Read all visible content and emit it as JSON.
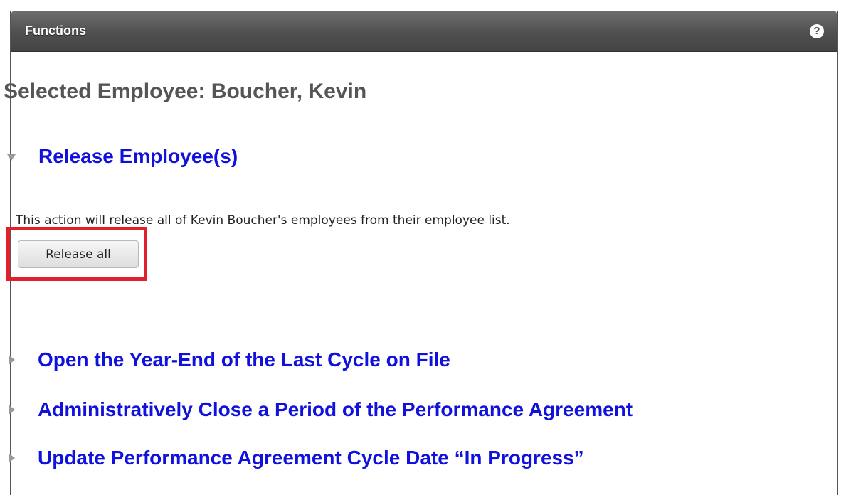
{
  "header": {
    "title": "Functions",
    "help_icon": "question-mark-icon",
    "help_glyph": "?"
  },
  "selected_employee": "Selected Employee: Boucher, Kevin",
  "release_section": {
    "title": "Release Employee(s)",
    "expanded": true,
    "description": "This action will release all of Kevin Boucher's employees from their employee list.",
    "button_label": "Release all",
    "highlight_color": "#e0212b"
  },
  "collapsed_sections": [
    "Open the Year-End of the Last Cycle on File",
    "Administratively Close a Period of the Performance Agreement",
    "Update Performance Agreement Cycle Date “In Progress”"
  ],
  "colors": {
    "link": "#1111dd",
    "header_bg": "#555555"
  }
}
